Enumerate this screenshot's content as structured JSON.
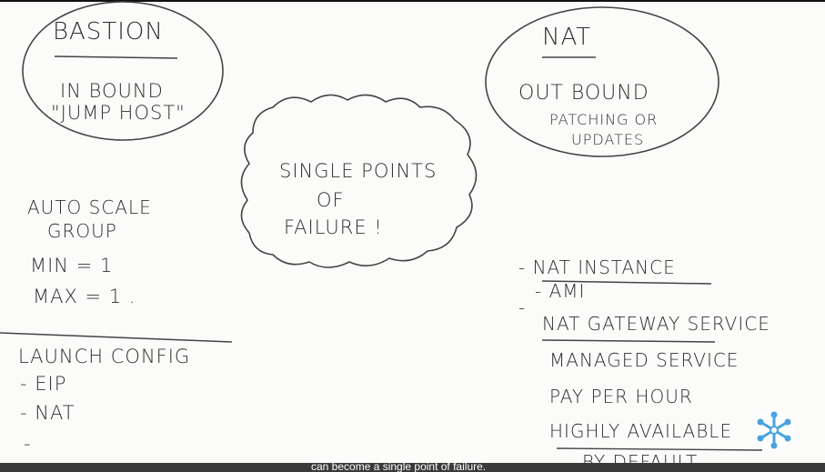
{
  "bastion": {
    "title": "BASTION",
    "line1": "IN BOUND",
    "line2": "\"JUMP HOST\""
  },
  "nat": {
    "title": "NAT",
    "line1": "OUT BOUND",
    "line2": "PATCHING OR",
    "line3": "UPDATES"
  },
  "cloud": {
    "line1": "SINGLE POINTS",
    "line2": "OF",
    "line3": "FAILURE !"
  },
  "asg": {
    "line1": "AUTO SCALE",
    "line2": "GROUP",
    "min": "MIN = 1",
    "max": "MAX = 1 ."
  },
  "launch": {
    "title": "LAUNCH CONFIG",
    "item1": "- EIP",
    "item2": "- NAT",
    "item3": "-"
  },
  "nat_options": {
    "instance_title": "- NAT INSTANCE",
    "instance_item": "- AMI",
    "dash": "-",
    "gateway_title": "NAT GATEWAY SERVICE",
    "gateway_items": [
      "MANAGED SERVICE",
      "PAY PER HOUR",
      "HIGHLY AVAILABLE",
      "BY DEFAULT"
    ]
  },
  "caption": "can become a single point of failure.",
  "colors": {
    "ink": "#303030",
    "caption_bg": "#3a3a3a",
    "logo": "#4aa3df"
  },
  "icons": {
    "logo": "snowflake-logo-icon"
  }
}
